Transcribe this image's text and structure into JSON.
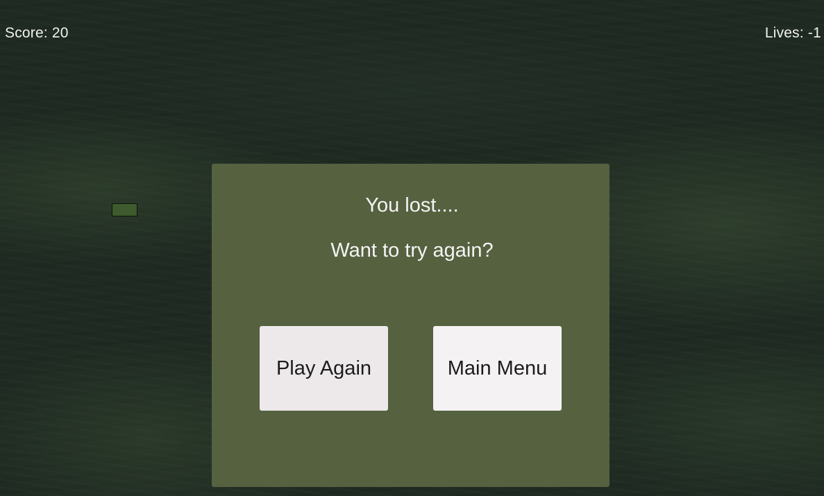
{
  "hud": {
    "score": "Score: 20",
    "lives": "Lives: -1"
  },
  "dialog": {
    "title": "You lost....",
    "question": "Want to try again?",
    "play_again_label": "Play Again",
    "main_menu_label": "Main Menu"
  },
  "colors": {
    "background": "#1f2a22",
    "dialog": "#566140",
    "brick": "#3f5a2c",
    "button": "#ede9eb",
    "hud_text": "#f2f2f2"
  }
}
